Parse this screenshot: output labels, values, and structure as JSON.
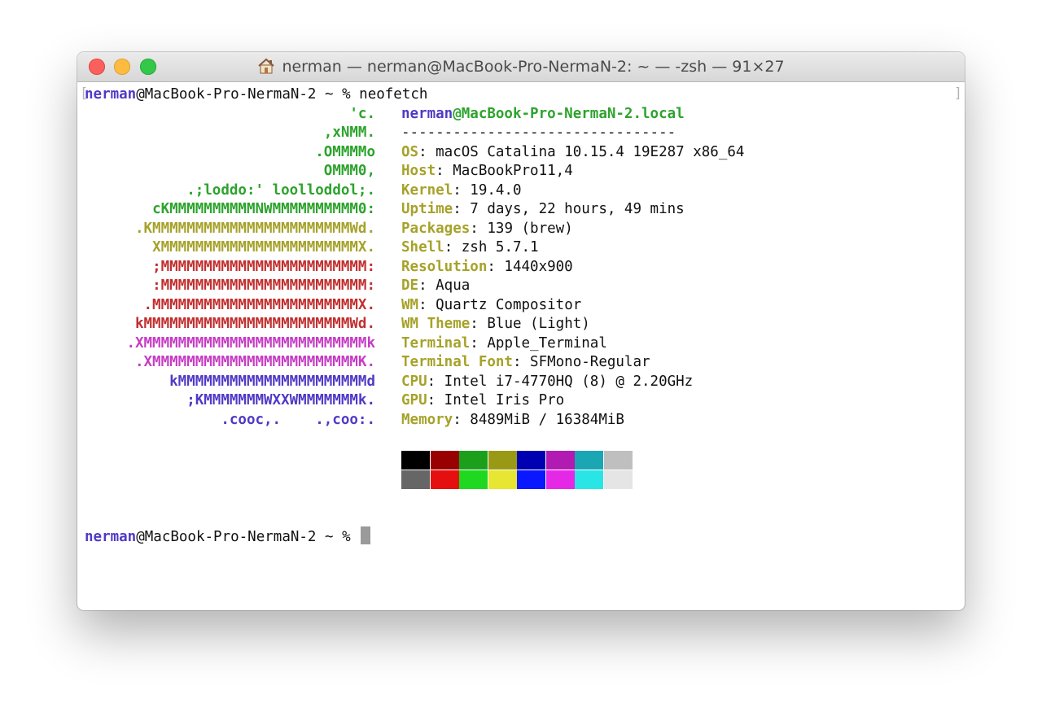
{
  "window": {
    "title": "nerman — nerman@MacBook-Pro-NermaN-2: ~ — -zsh — 91×27"
  },
  "prompt1": {
    "user": "nerman",
    "host": "@MacBook-Pro-NermaN-2 ~ % ",
    "command": "neofetch"
  },
  "logo": [
    {
      "text": "'c.",
      "color": "green"
    },
    {
      "text": ",xNMM.",
      "color": "green"
    },
    {
      "text": ".OMMMMo",
      "color": "green"
    },
    {
      "text": "OMMM0,",
      "color": "green"
    },
    {
      "text": ".;loddo:' loolloddol;.",
      "color": "green"
    },
    {
      "text": "cKMMMMMMMMMMNWMMMMMMMMMM0:",
      "color": "green"
    },
    {
      "text": ".KMMMMMMMMMMMMMMMMMMMMMMMWd.",
      "color": "yellow"
    },
    {
      "text": "XMMMMMMMMMMMMMMMMMMMMMMMX.",
      "color": "yellow"
    },
    {
      "text": ";MMMMMMMMMMMMMMMMMMMMMMMM:",
      "color": "red"
    },
    {
      "text": ":MMMMMMMMMMMMMMMMMMMMMMMM:",
      "color": "red"
    },
    {
      "text": ".MMMMMMMMMMMMMMMMMMMMMMMMX.",
      "color": "red"
    },
    {
      "text": "kMMMMMMMMMMMMMMMMMMMMMMMMWd.",
      "color": "red"
    },
    {
      "text": ".XMMMMMMMMMMMMMMMMMMMMMMMMMMk",
      "color": "magenta"
    },
    {
      "text": ".XMMMMMMMMMMMMMMMMMMMMMMMMK.",
      "color": "magenta"
    },
    {
      "text": "kMMMMMMMMMMMMMMMMMMMMMMd",
      "color": "blue"
    },
    {
      "text": ";KMMMMMMMWXXWMMMMMMMk.",
      "color": "blue"
    },
    {
      "text": ".cooc,.    .,coo:.",
      "color": "blue"
    }
  ],
  "info": {
    "user": "nerman",
    "host": "@MacBook-Pro-NermaN-2.local",
    "separator": "--------------------------------",
    "rows": [
      {
        "key": "OS",
        "value": ": macOS Catalina 10.15.4 19E287 x86_64"
      },
      {
        "key": "Host",
        "value": ": MacBookPro11,4"
      },
      {
        "key": "Kernel",
        "value": ": 19.4.0"
      },
      {
        "key": "Uptime",
        "value": ": 7 days, 22 hours, 49 mins"
      },
      {
        "key": "Packages",
        "value": ": 139 (brew)"
      },
      {
        "key": "Shell",
        "value": ": zsh 5.7.1"
      },
      {
        "key": "Resolution",
        "value": ": 1440x900"
      },
      {
        "key": "DE",
        "value": ": Aqua"
      },
      {
        "key": "WM",
        "value": ": Quartz Compositor"
      },
      {
        "key": "WM Theme",
        "value": ": Blue (Light)"
      },
      {
        "key": "Terminal",
        "value": ": Apple_Terminal"
      },
      {
        "key": "Terminal Font",
        "value": ": SFMono-Regular"
      },
      {
        "key": "CPU",
        "value": ": Intel i7-4770HQ (8) @ 2.20GHz"
      },
      {
        "key": "GPU",
        "value": ": Intel Iris Pro"
      },
      {
        "key": "Memory",
        "value": ": 8489MiB / 16384MiB"
      }
    ]
  },
  "palette": {
    "normal": [
      "#000000",
      "#990000",
      "#1ca01c",
      "#999916",
      "#0000b3",
      "#b21bb2",
      "#1aa6b3",
      "#bfbfbf"
    ],
    "bright": [
      "#666666",
      "#e60f0f",
      "#1fd81f",
      "#e6e633",
      "#0a18ff",
      "#e528e5",
      "#29e5e5",
      "#e5e5e5"
    ]
  },
  "prompt2": {
    "user": "nerman",
    "host": "@MacBook-Pro-NermaN-2 ~ % "
  },
  "colors": {
    "green": "#2da32d",
    "yellow": "#a6a22a",
    "red": "#c22f2f",
    "magenta": "#c63cc4",
    "blue": "#5139c6"
  }
}
